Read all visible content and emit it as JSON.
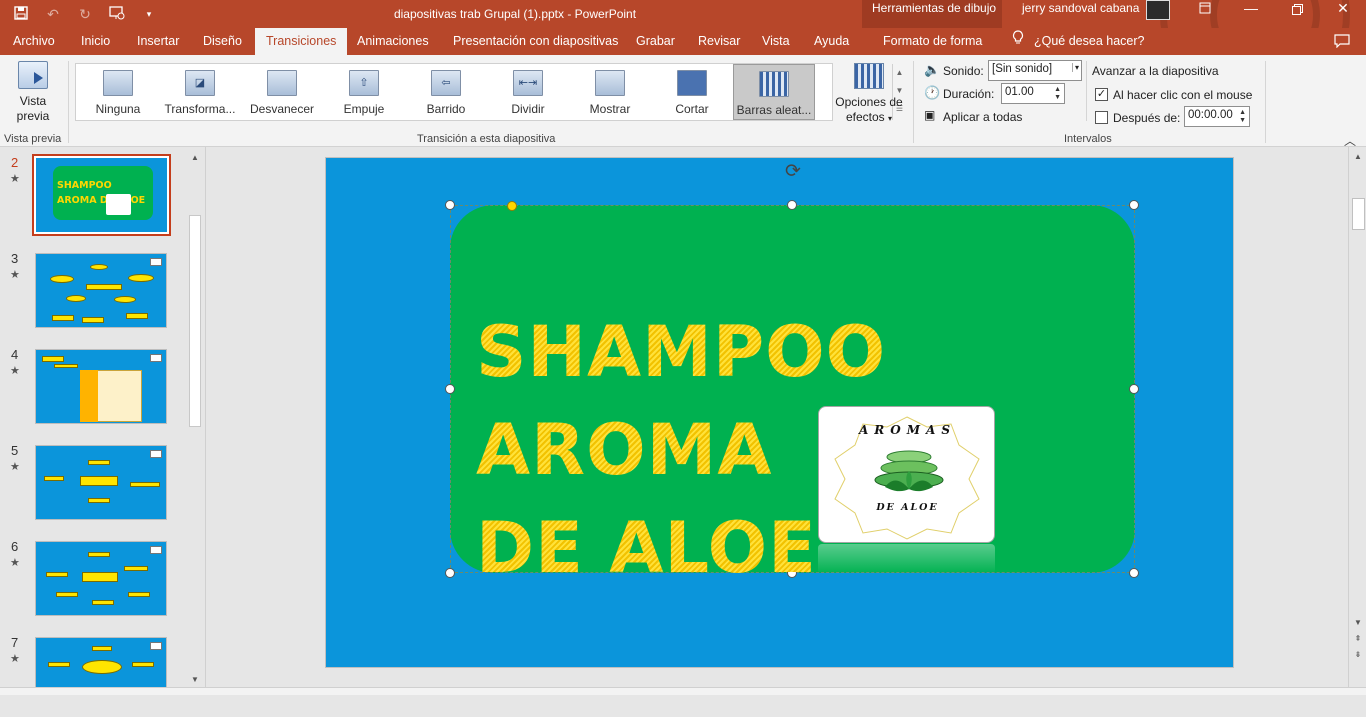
{
  "titlebar": {
    "document_title": "diapositivas trab Grupal (1).pptx  -  PowerPoint",
    "contextual_group": "Herramientas de dibujo",
    "user_name": "jerry sandoval cabana",
    "qat_icons": [
      "save-icon",
      "undo-icon",
      "redo-icon",
      "present-from-start-icon",
      "customize-qat-icon"
    ],
    "window_controls": [
      "ribbon-display-options-icon",
      "minimize-icon",
      "restore-icon",
      "close-icon"
    ]
  },
  "menu": {
    "tabs": [
      "Archivo",
      "Inicio",
      "Insertar",
      "Diseño",
      "Transiciones",
      "Animaciones",
      "Presentación con diapositivas",
      "Grabar",
      "Revisar",
      "Vista",
      "Ayuda",
      "Formato de forma"
    ],
    "active_tab": "Transiciones",
    "tell_me": "¿Qué desea hacer?"
  },
  "ribbon": {
    "preview": {
      "label_line1": "Vista",
      "label_line2": "previa",
      "group_label": "Vista previa"
    },
    "transitions": {
      "items": [
        "Ninguna",
        "Transforma...",
        "Desvanecer",
        "Empuje",
        "Barrido",
        "Dividir",
        "Mostrar",
        "Cortar",
        "Barras aleat..."
      ],
      "selected": "Barras aleat...",
      "group_label": "Transición a esta diapositiva",
      "effect_options_line1": "Opciones de",
      "effect_options_line2": "efectos"
    },
    "timing": {
      "sound_label": "Sonido:",
      "sound_value": "[Sin sonido]",
      "duration_label": "Duración:",
      "duration_value": "01.00",
      "apply_all_label": "Aplicar a todas",
      "advance_label": "Avanzar a la diapositiva",
      "on_click_label": "Al hacer clic con el mouse",
      "on_click_checked": true,
      "after_label": "Después de:",
      "after_checked": false,
      "after_value": "00:00.00",
      "group_label": "Intervalos"
    }
  },
  "thumbnails": [
    {
      "number": "2",
      "star": "★",
      "active": true,
      "text": "SHAMPOO AROMA DE ALOE"
    },
    {
      "number": "3",
      "star": "★",
      "active": false
    },
    {
      "number": "4",
      "star": "★",
      "active": false
    },
    {
      "number": "5",
      "star": "★",
      "active": false
    },
    {
      "number": "6",
      "star": "★",
      "active": false
    },
    {
      "number": "7",
      "star": "★",
      "active": false
    }
  ],
  "slide": {
    "title": "SHAMPOO AROMA\nDE ALOE",
    "logo_top_text": "AROMAS",
    "logo_bottom_text": "DE ALOE",
    "colors": {
      "background": "#0b95db",
      "shape": "#00b150",
      "title": "#ffd700"
    }
  }
}
